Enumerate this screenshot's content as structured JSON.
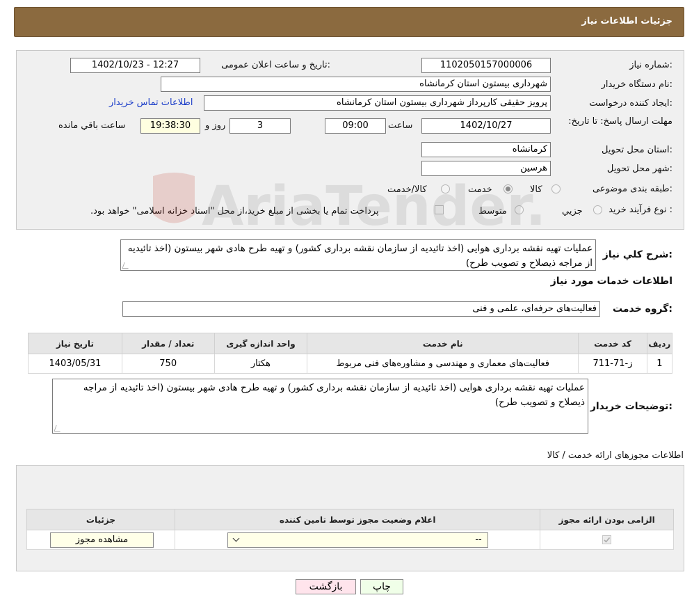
{
  "header": {
    "title": "جزئیات اطلاعات نیاز"
  },
  "form": {
    "need_number_label": "شماره نیاز:",
    "need_number": "1102050157000006",
    "announce_label": "تاریخ و ساعت اعلان عمومی:",
    "announce_value": "1402/10/23 - 12:27",
    "buyer_org_label": "نام دستگاه خریدار:",
    "buyer_org": "شهرداری بیستون استان کرمانشاه",
    "creator_label": "ایجاد کننده درخواست:",
    "creator": "پرویز حقیقی کارپرداز شهرداری بیستون استان کرمانشاه",
    "contact_link": "اطلاعات تماس خریدار",
    "deadline_label": "مهلت ارسال پاسخ: تا تاریخ:",
    "deadline_date": "1402/10/27",
    "time_label": "ساعت",
    "deadline_time": "09:00",
    "days_value": "3",
    "days_label": "روز و",
    "remaining_time": "19:38:30",
    "remaining_label": "ساعت باقي مانده",
    "province_label": "استان محل تحویل:",
    "province": "کرمانشاه",
    "city_label": "شهر محل تحویل:",
    "city": "هرسین",
    "category_label": "طبقه بندی موضوعی:",
    "category_options": [
      {
        "label": "کالا",
        "checked": false
      },
      {
        "label": "خدمت",
        "checked": true
      },
      {
        "label": "کالا/خدمت",
        "checked": false
      }
    ],
    "process_label": "نوع فرآیند خرید :",
    "process_options": [
      {
        "label": "جزیي",
        "checked": false
      },
      {
        "label": "متوسط",
        "checked": false
      }
    ],
    "payment_note": "پرداخت تمام یا بخشی از مبلغ خرید،از محل \"اسناد خزانه اسلامی\" خواهد بود."
  },
  "summary": {
    "label": "شرح کلي نياز:",
    "text": "عملیات تهیه نقشه برداری هوایی (اخذ تائیدیه از سازمان نقشه برداری کشور) و تهیه طرح هادی شهر بیستون (اخذ تائیدیه از مراجه ذیصلاح و تصویب طرح)"
  },
  "services": {
    "title": "اطلاعات خدمات مورد نیاز",
    "group_label": "گروه خدمت:",
    "group_value": "فعالیت‌های حرفه‌ای، علمی و فنی",
    "columns": [
      "ردیف",
      "کد خدمت",
      "نام خدمت",
      "واحد اندازه گیری",
      "تعداد / مقدار",
      "تاریخ نیاز"
    ],
    "rows": [
      [
        "1",
        "ز-71-711",
        "فعالیت‌های معماری و مهندسی و مشاوره‌های فنی مربوط",
        "هکتار",
        "750",
        "1403/05/31"
      ]
    ]
  },
  "buyer_notes": {
    "label": "توضیحات خریدار:",
    "text": "عملیات تهیه نقشه برداری هوایی (اخذ تائیدیه از سازمان نقشه برداری کشور) و تهیه طرح هادی شهر بیستون (اخذ تائیدیه از مراجه ذیصلاح و تصویب طرح)"
  },
  "licenses": {
    "title": "اطلاعات مجوزهای ارائه خدمت / کالا",
    "columns": [
      "الزامی بودن ارائه مجوز",
      "اعلام وضعیت مجوز توسط تامین کننده",
      "جزئیات"
    ],
    "select_value": "--",
    "view_button": "مشاهده مجوز"
  },
  "footer": {
    "print_button": "چاپ",
    "back_button": "بازگشت"
  },
  "watermark": "AriaTender.neT"
}
